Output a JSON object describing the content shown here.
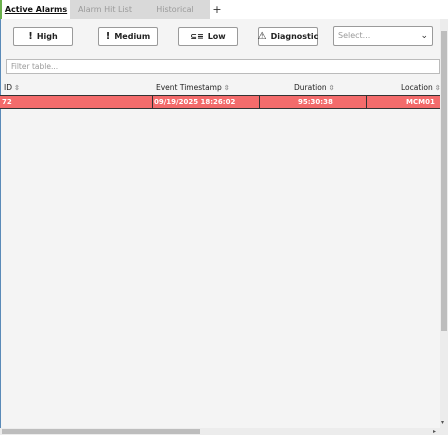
{
  "tabs": [
    {
      "label": "Active Alarms",
      "active": true
    },
    {
      "label": "Alarm Hit List",
      "active": false
    },
    {
      "label": "Historical",
      "active": false
    }
  ],
  "add_tab_label": "+",
  "filters": {
    "high": {
      "label": "High",
      "icon": "!"
    },
    "medium": {
      "label": "Medium",
      "icon": "!"
    },
    "low": {
      "label": "Low",
      "icon": "⊆≡"
    },
    "diagnostic": {
      "label": "Diagnostic",
      "icon": "⚠"
    }
  },
  "select": {
    "placeholder": "Select...",
    "icon": "⌄"
  },
  "filter_table": {
    "placeholder": "Filter table..."
  },
  "columns": [
    "ID",
    "Event Timestamp",
    "Duration",
    "Location"
  ],
  "sort_icon": "⇳",
  "rows": [
    {
      "id": "72",
      "timestamp": "09/19/2025 18:26:02",
      "duration": "95:30:38",
      "location": "MCM01"
    }
  ],
  "colors": {
    "high_row": "#f36b6b",
    "accent": "#6ab04c"
  },
  "scroll": {
    "down_arrow": "▾",
    "right_arrow": "▸"
  }
}
